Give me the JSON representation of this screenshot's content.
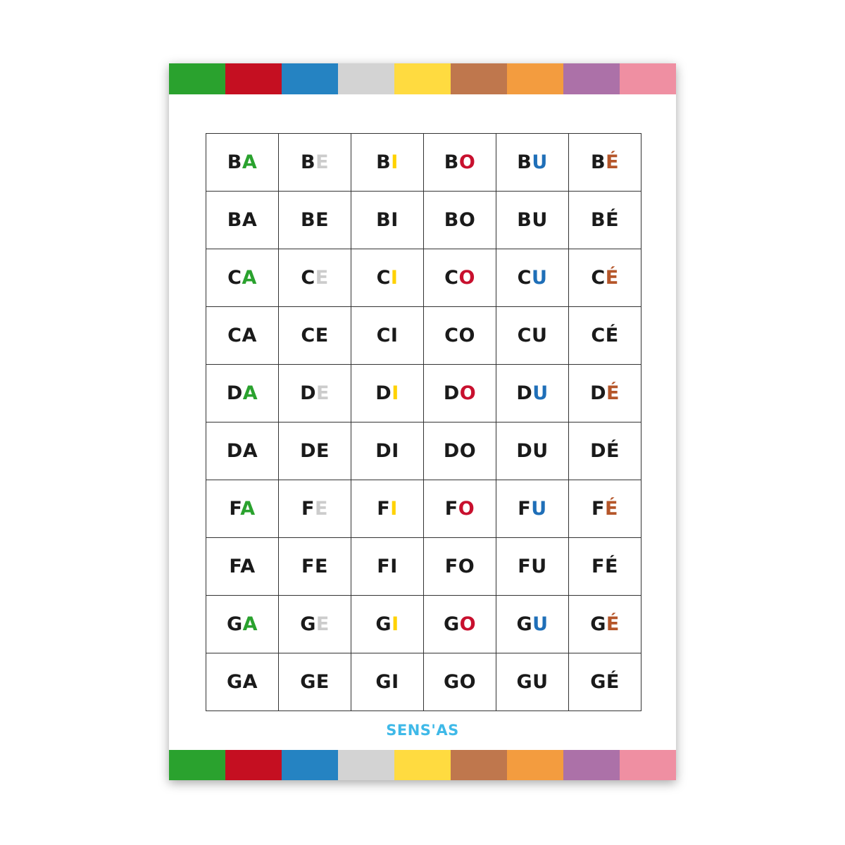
{
  "color_bar": [
    "#2aa22e",
    "#c50f21",
    "#2583c2",
    "#d3d3d3",
    "#ffdb40",
    "#bf774d",
    "#f39c3f",
    "#ac71a8",
    "#ef8fa2"
  ],
  "vowels": [
    {
      "letter": "A",
      "color": "#2aa22e"
    },
    {
      "letter": "E",
      "color": "#cccccc"
    },
    {
      "letter": "I",
      "color": "#ffd200"
    },
    {
      "letter": "O",
      "color": "#c8102e"
    },
    {
      "letter": "U",
      "color": "#1f6fb8"
    },
    {
      "letter": "É",
      "color": "#b5562a"
    }
  ],
  "rows": [
    {
      "consonant": "B",
      "colored": true
    },
    {
      "consonant": "B",
      "colored": false
    },
    {
      "consonant": "C",
      "colored": true
    },
    {
      "consonant": "C",
      "colored": false
    },
    {
      "consonant": "D",
      "colored": true
    },
    {
      "consonant": "D",
      "colored": false
    },
    {
      "consonant": "F",
      "colored": true
    },
    {
      "consonant": "F",
      "colored": false
    },
    {
      "consonant": "G",
      "colored": true
    },
    {
      "consonant": "G",
      "colored": false
    }
  ],
  "logo": "SENS'AS"
}
